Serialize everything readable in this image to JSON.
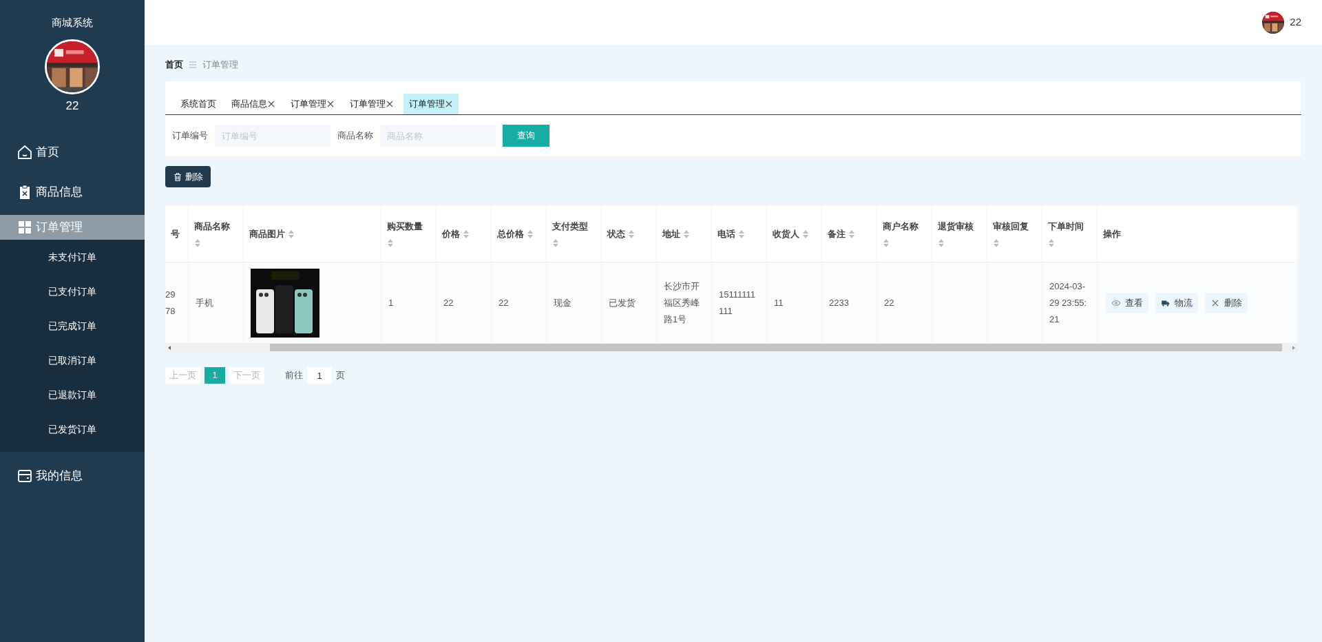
{
  "sidebar": {
    "title": "商城系统",
    "user": "22",
    "items": [
      {
        "label": "首页",
        "selected": false
      },
      {
        "label": "商品信息",
        "selected": false
      },
      {
        "label": "订单管理",
        "selected": true,
        "children": [
          {
            "label": "未支付订单"
          },
          {
            "label": "已支付订单"
          },
          {
            "label": "已完成订单"
          },
          {
            "label": "已取消订单"
          },
          {
            "label": "已退款订单"
          },
          {
            "label": "已发货订单"
          }
        ]
      },
      {
        "label": "我的信息",
        "selected": false
      }
    ]
  },
  "header": {
    "user": "22"
  },
  "breadcrumb": {
    "home": "首页",
    "current": "订单管理"
  },
  "tabs": [
    {
      "label": "系统首页",
      "closable": false,
      "selected": false
    },
    {
      "label": "商品信息",
      "closable": true,
      "selected": false
    },
    {
      "label": "订单管理",
      "closable": true,
      "selected": false
    },
    {
      "label": "订单管理",
      "closable": true,
      "selected": false
    },
    {
      "label": "订单管理",
      "closable": true,
      "selected": true
    }
  ],
  "search": {
    "fields": [
      {
        "label": "订单编号",
        "placeholder": "订单编号"
      },
      {
        "label": "商品名称",
        "placeholder": "商品名称"
      }
    ],
    "button": "查询"
  },
  "delete_button": "删除",
  "table": {
    "columns": [
      {
        "label": "号",
        "sortable": false
      },
      {
        "label": "商品名称",
        "sortable": true
      },
      {
        "label": "商品图片",
        "sortable": true
      },
      {
        "label": "购买数量",
        "sortable": true
      },
      {
        "label": "价格",
        "sortable": true
      },
      {
        "label": "总价格",
        "sortable": true
      },
      {
        "label": "支付类型",
        "sortable": true
      },
      {
        "label": "状态",
        "sortable": true
      },
      {
        "label": "地址",
        "sortable": true
      },
      {
        "label": "电话",
        "sortable": true
      },
      {
        "label": "收货人",
        "sortable": true
      },
      {
        "label": "备注",
        "sortable": true
      },
      {
        "label": "商户名称",
        "sortable": true
      },
      {
        "label": "退货审核",
        "sortable": true
      },
      {
        "label": "审核回复",
        "sortable": true
      },
      {
        "label": "下单时间",
        "sortable": true
      },
      {
        "label": "操作",
        "sortable": false
      }
    ],
    "rows": [
      {
        "cells": [
          {
            "kind": "text",
            "text": "29\n78"
          },
          {
            "kind": "text",
            "text": "手机"
          },
          {
            "kind": "picture"
          },
          {
            "kind": "text",
            "text": "1"
          },
          {
            "kind": "text",
            "text": "22"
          },
          {
            "kind": "text",
            "text": "22"
          },
          {
            "kind": "text",
            "text": "现金"
          },
          {
            "kind": "text",
            "text": "已发货"
          },
          {
            "kind": "text",
            "text": "长沙市开福区秀峰路1号"
          },
          {
            "kind": "text",
            "text": "15111111111"
          },
          {
            "kind": "text",
            "text": "11"
          },
          {
            "kind": "text",
            "text": "2233"
          },
          {
            "kind": "text",
            "text": "22"
          },
          {
            "kind": "empty"
          },
          {
            "kind": "empty"
          },
          {
            "kind": "text",
            "text": "2024-03-29 23:55:21"
          },
          {
            "kind": "actions",
            "actions": [
              {
                "label": "查看"
              },
              {
                "label": "物流"
              },
              {
                "label": "删除"
              }
            ]
          }
        ]
      }
    ]
  },
  "pagination": {
    "prev": {
      "label": "上一页",
      "disabled": true
    },
    "pages": [
      {
        "label": "1",
        "selected": true
      }
    ],
    "next": {
      "label": "下一页",
      "disabled": true
    },
    "goto": "前往",
    "goto_value": "1",
    "goto_suffix": "页"
  }
}
